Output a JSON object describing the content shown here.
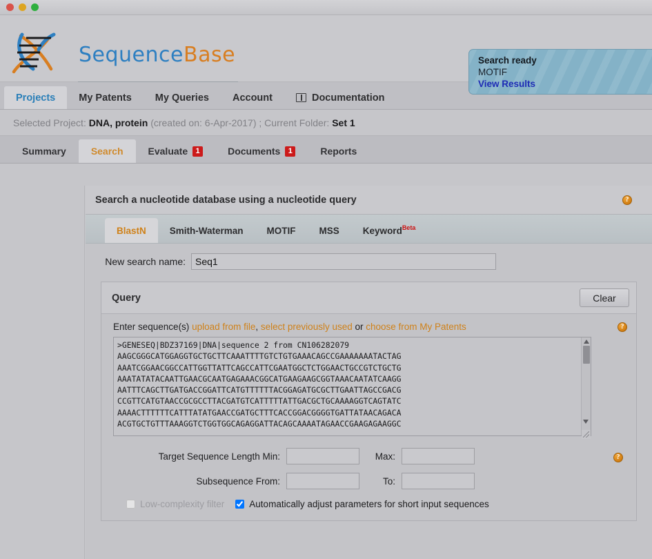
{
  "window": {
    "traffic_lights": [
      "close",
      "minimize",
      "zoom"
    ]
  },
  "header": {
    "logo_first": "Sequence",
    "logo_second": "Base",
    "logo_colors": {
      "blue": "#2d7fc1",
      "orange": "#d87e21"
    },
    "status": {
      "line1": "Search ready",
      "line2": "MOTIF",
      "link": "View Results",
      "bg_color": "#84b2c7"
    }
  },
  "topnav": {
    "items": [
      {
        "label": "Projects",
        "active": true,
        "icon": null
      },
      {
        "label": "My Patents",
        "active": false,
        "icon": null
      },
      {
        "label": "My Queries",
        "active": false,
        "icon": null
      },
      {
        "label": "Account",
        "active": false,
        "icon": null
      },
      {
        "label": "Documentation",
        "active": false,
        "icon": "book-icon"
      }
    ]
  },
  "projectbar": {
    "selected_project_label": "Selected Project:",
    "project_name": "DNA, protein",
    "created_on": "(created on: 6-Apr-2017) ;",
    "current_folder_label": "Current Folder:",
    "folder_name": "Set 1"
  },
  "subtabs": {
    "items": [
      {
        "label": "Summary",
        "active": false,
        "badge": null
      },
      {
        "label": "Search",
        "active": true,
        "badge": null
      },
      {
        "label": "Evaluate",
        "active": false,
        "badge": "1"
      },
      {
        "label": "Documents",
        "active": false,
        "badge": "1"
      },
      {
        "label": "Reports",
        "active": false,
        "badge": null
      }
    ],
    "badge_color": "#cc1a1a"
  },
  "panel": {
    "heading": "Search a nucleotide database using a nucleotide query",
    "help_glyph": "?",
    "method_tabs": [
      {
        "label": "BlastN",
        "active": true,
        "sup": null
      },
      {
        "label": "Smith-Waterman",
        "active": false,
        "sup": null
      },
      {
        "label": "MOTIF",
        "active": false,
        "sup": null
      },
      {
        "label": "MSS",
        "active": false,
        "sup": null
      },
      {
        "label": "Keyword",
        "active": false,
        "sup": "Beta"
      }
    ],
    "accent_color": "#cf8119"
  },
  "form": {
    "search_name_label": "New search name:",
    "search_name_value": "Seq1",
    "search_name_placeholder": "",
    "query_title": "Query",
    "clear_button": "Clear",
    "enter_prefix": "Enter sequence(s)",
    "link_upload": "upload from file",
    "separator_comma": ", ",
    "link_select_prev": "select previously used",
    "word_or": " or ",
    "link_my_patents": "choose from My Patents",
    "sequence_text": ">GENESEQ|BDZ37169|DNA|sequence 2 from CN106282079\nAAGCGGGCATGGAGGTGCTGCTTCAAATTTTGTCTGTGAAACAGCCGAAAAAAATACTAG\nAAATCGGAACGGCCATTGGTTATTCAGCCATTCGAATGGCTCTGGAACTGCCGTCTGCTG\nAAATATATACAATTGAACGCAATGAGAAACGGCATGAAGAAGCGGTAAACAATATCAAGG\nAATTTCAGCTTGATGACCGGATTCATGTTTTTTACGGAGATGCGCTTGAATTAGCCGACG\nCCGTTCATGTAACCGCGCCTTACGATGTCATTTTTATTGACGCTGCAAAAGGTCAGTATC\nAAAACTTTTTTCATTTATATGAACCGATGCTTTCACCGGACGGGGTGATTATAACAGACA\nACGTGCTGTTTAAAGGTCTGGTGGCAGAGGATTACAGCAAAATAGAACCGAAGAGAAGGC",
    "target_min_label": "Target Sequence Length Min:",
    "target_min_value": "",
    "target_max_label": "Max:",
    "target_max_value": "",
    "subseq_from_label": "Subsequence From:",
    "subseq_from_value": "",
    "subseq_to_label": "To:",
    "subseq_to_value": "",
    "low_complexity_label": "Low-complexity filter",
    "low_complexity_checked": false,
    "low_complexity_disabled": true,
    "auto_adjust_label": "Automatically adjust parameters for short input sequences",
    "auto_adjust_checked": true
  }
}
